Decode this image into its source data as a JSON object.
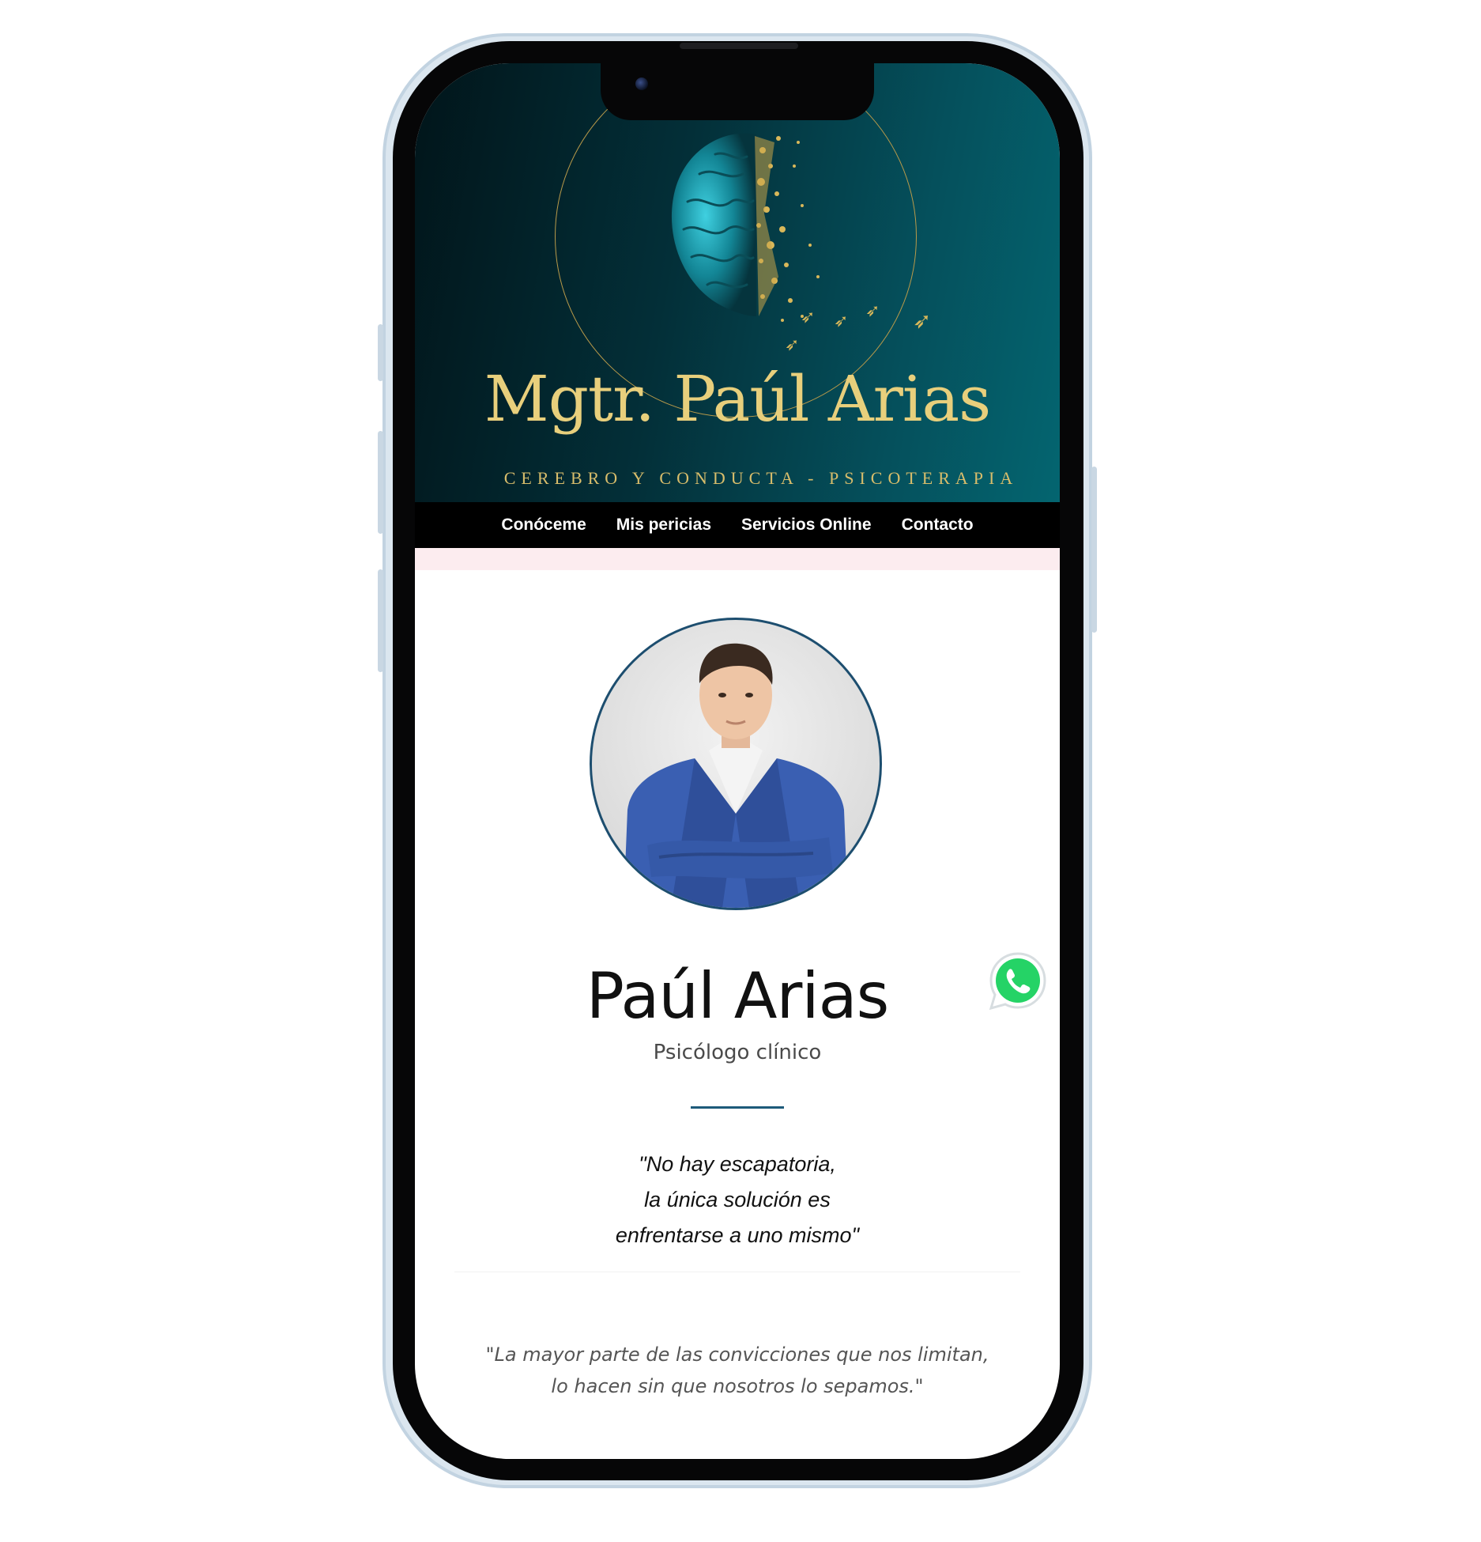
{
  "header": {
    "logo_title": "Mgtr. Paúl Arias",
    "logo_tagline": "CEREBRO Y CONDUCTA - PSICOTERAPIA"
  },
  "nav": {
    "items": [
      {
        "label": "Conóceme"
      },
      {
        "label": "Mis pericias"
      },
      {
        "label": "Servicios Online"
      },
      {
        "label": "Contacto"
      }
    ]
  },
  "profile": {
    "name": "Paúl Arias",
    "role": "Psicólogo clínico"
  },
  "quote_main": {
    "lines": [
      "\"No hay escapatoria,",
      "la única solución es",
      "enfrentarse a uno mismo\""
    ]
  },
  "quote_secondary": {
    "lines": [
      "\"La mayor parte de las convicciones que nos limitan,",
      "lo hacen sin que nosotros lo sepamos.\""
    ]
  },
  "floating": {
    "whatsapp_icon": "whatsapp-icon"
  },
  "colors": {
    "header_gradient_start": "#01151a",
    "header_gradient_end": "#046570",
    "gold": "#e8cf7c",
    "nav_background": "#000000",
    "accent_blue": "#1d5a7a",
    "whatsapp_green": "#25d366"
  }
}
